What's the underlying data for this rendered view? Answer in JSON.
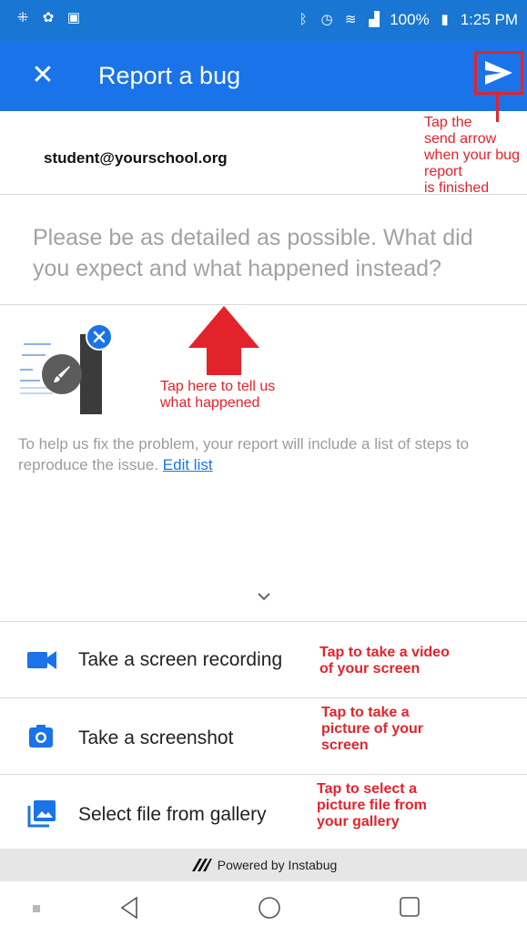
{
  "status_bar": {
    "battery": "100%",
    "time": "1:25 PM"
  },
  "app_bar": {
    "close_glyph": "✕",
    "title": "Report a bug",
    "send_icon": "send-arrow-icon"
  },
  "form": {
    "email": "student@yourschool.org",
    "description_placeholder": "Please be as detailed as possible. What did you expect and what happened instead?",
    "info_text": "To help us fix the problem, your report will include a list of steps to reproduce the issue.",
    "edit_list_link": "Edit list"
  },
  "actions": [
    {
      "label": "Take a screen recording",
      "icon": "video-camera-icon"
    },
    {
      "label": "Take a screenshot",
      "icon": "camera-icon"
    },
    {
      "label": "Select file from gallery",
      "icon": "gallery-icon"
    }
  ],
  "footer": {
    "powered_by": "Powered by Instabug"
  },
  "annotations": {
    "send": [
      "Tap the",
      "send arrow",
      "when your bug",
      "report",
      "is finished"
    ],
    "description": [
      "Tap here to tell us",
      "what happened"
    ],
    "recording": [
      "Tap to take a video",
      "of your screen"
    ],
    "screenshot": [
      "Tap to take a",
      "picture of your",
      "screen"
    ],
    "gallery": [
      "Tap to select a",
      "picture file from",
      "your gallery"
    ]
  },
  "colors": {
    "brand_blue": "#1a73e8",
    "annotation_red": "#e3232b",
    "page_background": "#fdf3d4"
  }
}
